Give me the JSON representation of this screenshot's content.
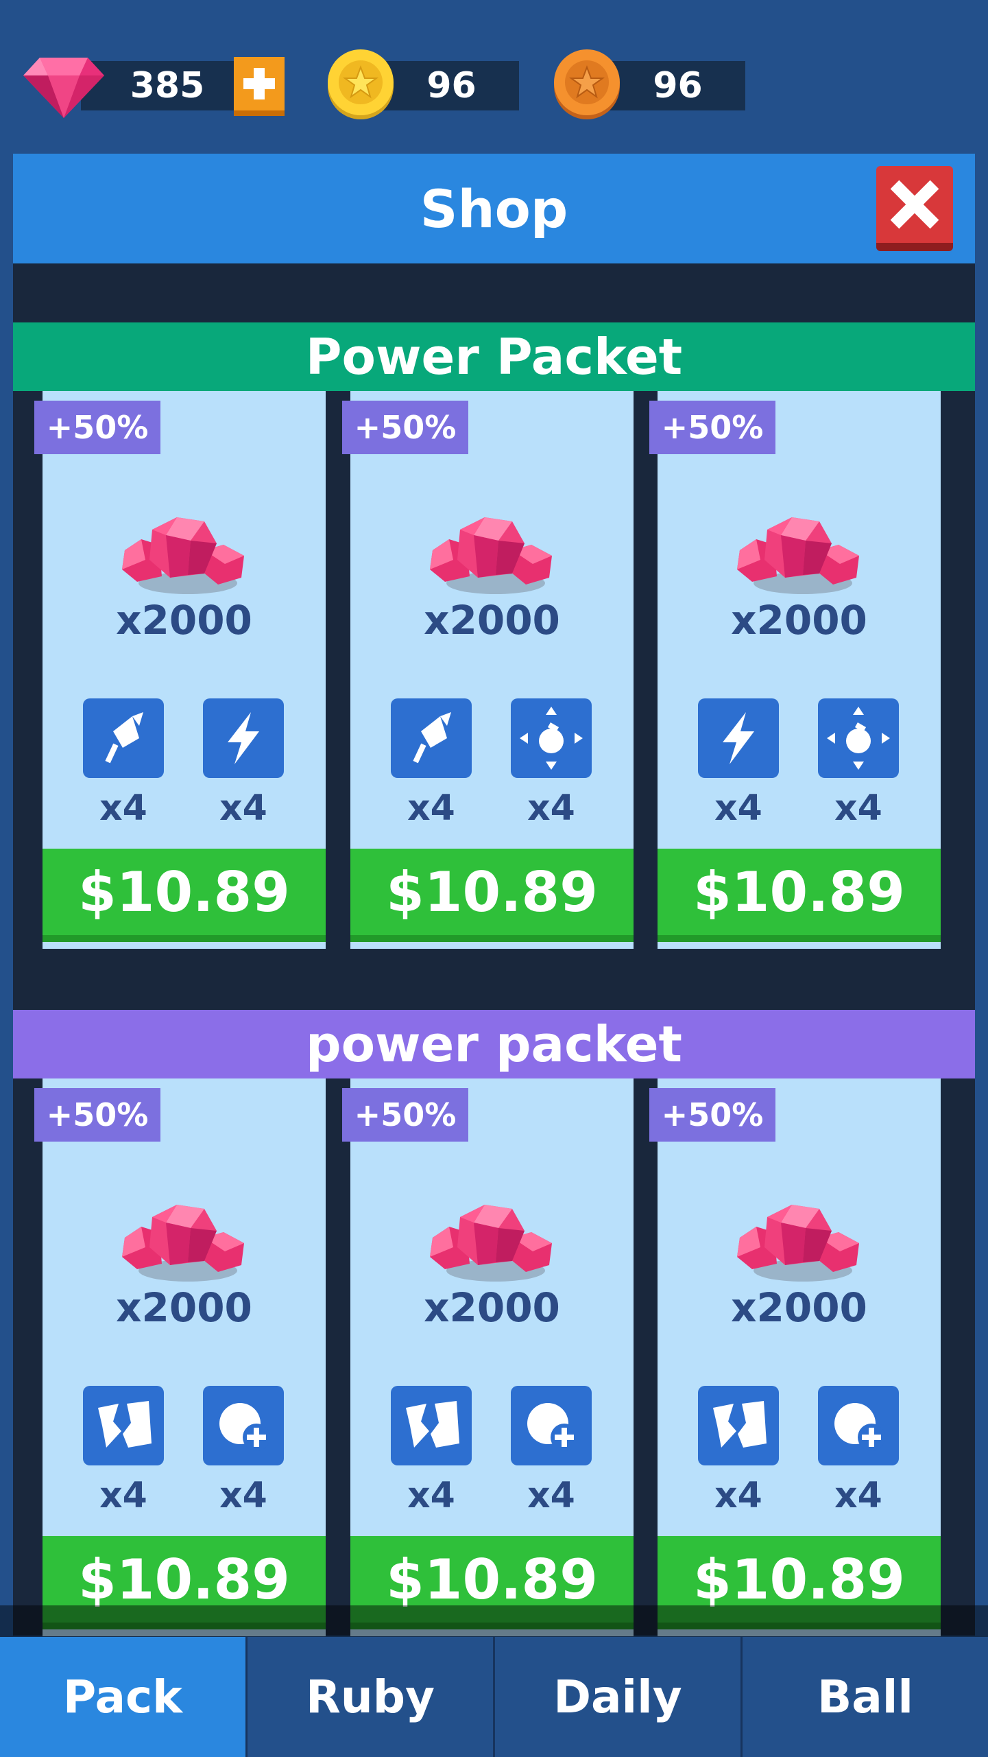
{
  "currency": {
    "gems": "385",
    "gold_coins": "96",
    "bronze_coins": "96"
  },
  "header": {
    "title": "Shop"
  },
  "sections": [
    {
      "title": "Power Packet",
      "color": "#08a87a",
      "cards": [
        {
          "badge": "+50%",
          "gem_amount": "x2000",
          "powerups": [
            {
              "icon": "rocket-icon",
              "count": "x4"
            },
            {
              "icon": "lightning-icon",
              "count": "x4"
            }
          ],
          "price": "$10.89"
        },
        {
          "badge": "+50%",
          "gem_amount": "x2000",
          "powerups": [
            {
              "icon": "rocket-icon",
              "count": "x4"
            },
            {
              "icon": "bomb-icon",
              "count": "x4"
            }
          ],
          "price": "$10.89"
        },
        {
          "badge": "+50%",
          "gem_amount": "x2000",
          "powerups": [
            {
              "icon": "lightning-icon",
              "count": "x4"
            },
            {
              "icon": "bomb-icon",
              "count": "x4"
            }
          ],
          "price": "$10.89"
        }
      ]
    },
    {
      "title": "power packet",
      "color": "#8b6ee8",
      "cards": [
        {
          "badge": "+50%",
          "gem_amount": "x2000",
          "powerups": [
            {
              "icon": "break-icon",
              "count": "x4"
            },
            {
              "icon": "add-ball-icon",
              "count": "x4"
            }
          ],
          "price": "$10.89"
        },
        {
          "badge": "+50%",
          "gem_amount": "x2000",
          "powerups": [
            {
              "icon": "break-icon",
              "count": "x4"
            },
            {
              "icon": "add-ball-icon",
              "count": "x4"
            }
          ],
          "price": "$10.89"
        },
        {
          "badge": "+50%",
          "gem_amount": "x2000",
          "powerups": [
            {
              "icon": "break-icon",
              "count": "x4"
            },
            {
              "icon": "add-ball-icon",
              "count": "x4"
            }
          ],
          "price": "$10.89"
        }
      ]
    }
  ],
  "tabs": [
    {
      "label": "Pack",
      "active": true
    },
    {
      "label": "Ruby",
      "active": false
    },
    {
      "label": "Daily",
      "active": false
    },
    {
      "label": "Ball",
      "active": false
    }
  ]
}
